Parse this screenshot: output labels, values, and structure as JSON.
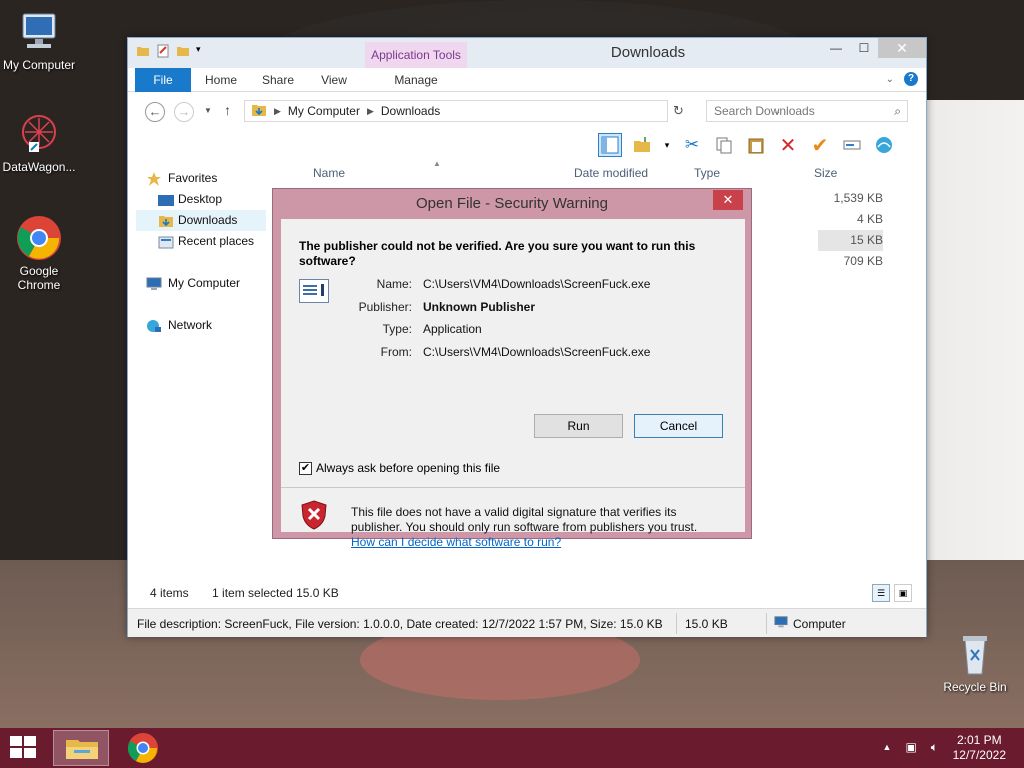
{
  "desktop": {
    "icons": [
      {
        "label": "My Computer"
      },
      {
        "label": "DataWagon..."
      },
      {
        "label": "Google Chrome"
      },
      {
        "label": "Recycle Bin"
      }
    ]
  },
  "explorer": {
    "title": "Downloads",
    "app_tools_label": "Application Tools",
    "tabs": {
      "file": "File",
      "home": "Home",
      "share": "Share",
      "view": "View",
      "manage": "Manage"
    },
    "address": {
      "segments": [
        "My Computer",
        "Downloads"
      ]
    },
    "search_placeholder": "Search Downloads",
    "nav": {
      "favorites": "Favorites",
      "desktop": "Desktop",
      "downloads": "Downloads",
      "recent": "Recent places",
      "my_computer": "My Computer",
      "network": "Network"
    },
    "columns": {
      "name": "Name",
      "date": "Date modified",
      "type": "Type",
      "size": "Size"
    },
    "sizes": [
      "1,539 KB",
      "4 KB",
      "15 KB",
      "709 KB"
    ],
    "status": {
      "items": "4 items",
      "selected": "1 item selected  15.0 KB"
    },
    "details": {
      "description": "File description: ScreenFuck, File version: 1.0.0.0, Date created: 12/7/2022 1:57 PM, Size: 15.0 KB",
      "size": "15.0 KB",
      "location": "Computer"
    }
  },
  "dialog": {
    "title": "Open File - Security Warning",
    "question": "The publisher could not be verified.  Are you sure you want to run this software?",
    "fields": {
      "name_label": "Name:",
      "name_value": "C:\\Users\\VM4\\Downloads\\ScreenFuck.exe",
      "publisher_label": "Publisher:",
      "publisher_value": "Unknown Publisher",
      "type_label": "Type:",
      "type_value": "Application",
      "from_label": "From:",
      "from_value": "C:\\Users\\VM4\\Downloads\\ScreenFuck.exe"
    },
    "run_label": "Run",
    "cancel_label": "Cancel",
    "checkbox_label": "Always ask before opening this file",
    "checkbox_checked": "✔",
    "warning_text": "This file does not have a valid digital signature that verifies its publisher.  You should only run software from publishers you trust.",
    "link_text": "How can I decide what software to run?",
    "close_glyph": "✕"
  },
  "taskbar": {
    "time": "2:01 PM",
    "date": "12/7/2022"
  }
}
